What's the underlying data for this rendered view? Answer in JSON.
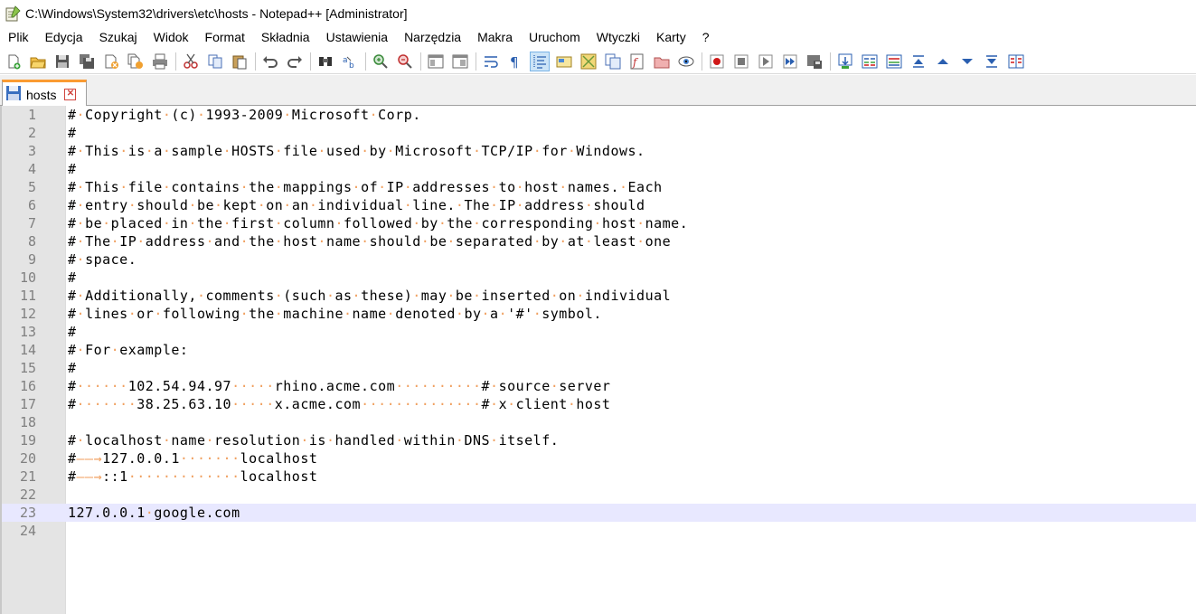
{
  "window": {
    "title": "C:\\Windows\\System32\\drivers\\etc\\hosts - Notepad++ [Administrator]"
  },
  "menu": [
    "Plik",
    "Edycja",
    "Szukaj",
    "Widok",
    "Format",
    "Składnia",
    "Ustawienia",
    "Narzędzia",
    "Makra",
    "Uruchom",
    "Wtyczki",
    "Karty",
    "?"
  ],
  "tab": {
    "label": "hosts"
  },
  "editor": {
    "current_line": 23,
    "lines": [
      "#·Copyright·(c)·1993-2009·Microsoft·Corp.",
      "#",
      "#·This·is·a·sample·HOSTS·file·used·by·Microsoft·TCP/IP·for·Windows.",
      "#",
      "#·This·file·contains·the·mappings·of·IP·addresses·to·host·names.·Each",
      "#·entry·should·be·kept·on·an·individual·line.·The·IP·address·should",
      "#·be·placed·in·the·first·column·followed·by·the·corresponding·host·name.",
      "#·The·IP·address·and·the·host·name·should·be·separated·by·at·least·one",
      "#·space.",
      "#",
      "#·Additionally,·comments·(such·as·these)·may·be·inserted·on·individual",
      "#·lines·or·following·the·machine·name·denoted·by·a·'#'·symbol.",
      "#",
      "#·For·example:",
      "#",
      "#······102.54.94.97·····rhino.acme.com··········#·source·server",
      "#·······38.25.63.10·····x.acme.com··············#·x·client·host",
      "",
      "#·localhost·name·resolution·is·handled·within·DNS·itself.",
      "#——→127.0.0.1·······localhost",
      "#——→::1·············localhost",
      "",
      "127.0.0.1·google.com",
      ""
    ]
  },
  "colors": {
    "whitespace": "#f0a060",
    "current_line_bg": "#e8e8ff",
    "gutter_bg": "#e4e4e4",
    "tab_accent": "#fa9b32"
  }
}
